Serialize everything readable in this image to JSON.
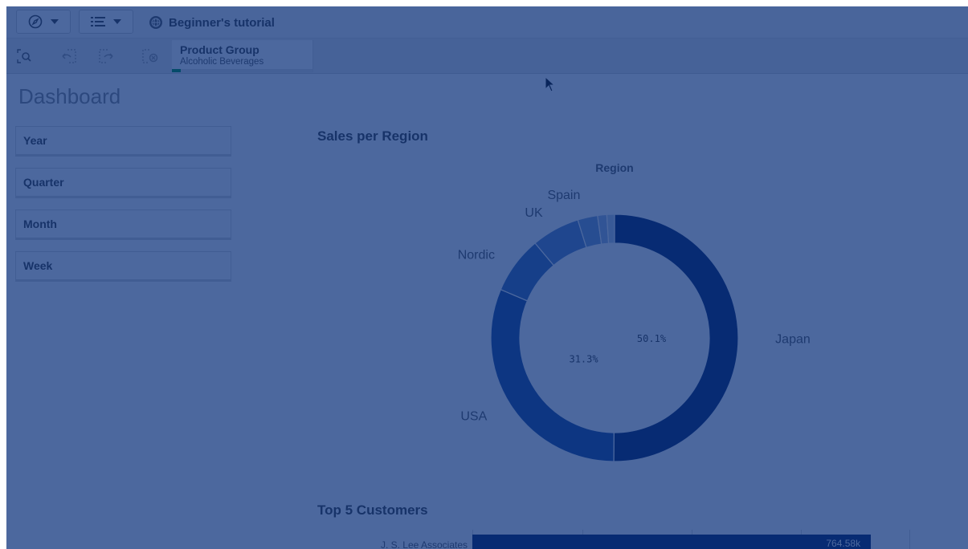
{
  "toolbar": {
    "nav_icon": "compass-icon",
    "list_icon": "list-icon",
    "app_title": "Beginner's tutorial"
  },
  "selection_bar": {
    "tools": [
      "smart-search-icon",
      "step-back-icon",
      "step-forward-icon",
      "clear-selections-icon"
    ],
    "chip": {
      "field": "Product Group",
      "value": "Alcoholic Beverages",
      "selected_fraction": 0.06
    }
  },
  "sheet": {
    "title": "Dashboard",
    "filters": [
      "Year",
      "Quarter",
      "Month",
      "Week"
    ]
  },
  "donut_chart": {
    "title": "Sales per Region",
    "colors": [
      "#0a2564",
      "#1f4d9a",
      "#3e6bb3",
      "#5f87c4",
      "#7c9fd1",
      "#9fb7de",
      "#b9cbe7"
    ]
  },
  "bar_chart": {
    "title": "Top 5 Customers",
    "visible_category": "J. S. Lee Associates",
    "visible_value_label": "764.58k"
  },
  "overlay_color": "#072e78",
  "chart_data": [
    {
      "type": "pie",
      "title": "Sales per Region",
      "legend_title": "Region",
      "categories": [
        "Japan",
        "USA",
        "Nordic",
        "UK",
        "Spain",
        "",
        ""
      ],
      "values": [
        50.1,
        31.3,
        7.5,
        6.3,
        2.6,
        1.2,
        1.0
      ],
      "data_labels": [
        "50.1%",
        "31.3%",
        "",
        "",
        "",
        "",
        ""
      ]
    },
    {
      "type": "bar",
      "title": "Top 5 Customers",
      "orientation": "horizontal",
      "categories": [
        "J. S. Lee Associates"
      ],
      "values": [
        764.58
      ],
      "value_labels": [
        "764.58k"
      ],
      "xlim": [
        0,
        800
      ]
    }
  ]
}
